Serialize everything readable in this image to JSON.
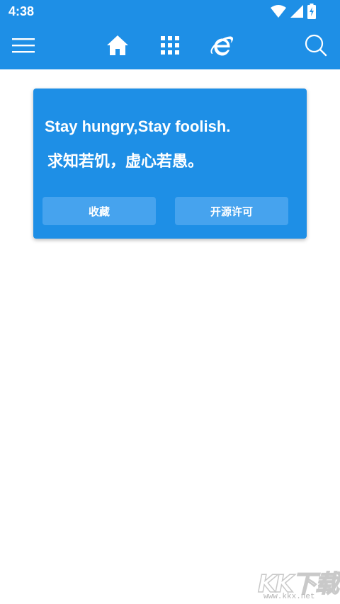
{
  "status_bar": {
    "time": "4:38",
    "icons": [
      "wifi-icon",
      "cellular-signal-icon",
      "battery-charging-icon"
    ]
  },
  "toolbar": {
    "icons": [
      "menu-icon",
      "home-icon",
      "grid-icon",
      "browser-e-icon",
      "search-icon"
    ]
  },
  "card": {
    "quote_en": "Stay hungry,Stay foolish.",
    "quote_cn": "求知若饥，虚心若愚。",
    "buttons": [
      {
        "label": "收藏"
      },
      {
        "label": "开源许可"
      }
    ]
  },
  "watermark": {
    "logo_text": "KK下载",
    "url": "www.kkx.net"
  },
  "colors": {
    "primary": "#1e8fe6",
    "button": "#46a3ee",
    "background": "#ffffff"
  }
}
